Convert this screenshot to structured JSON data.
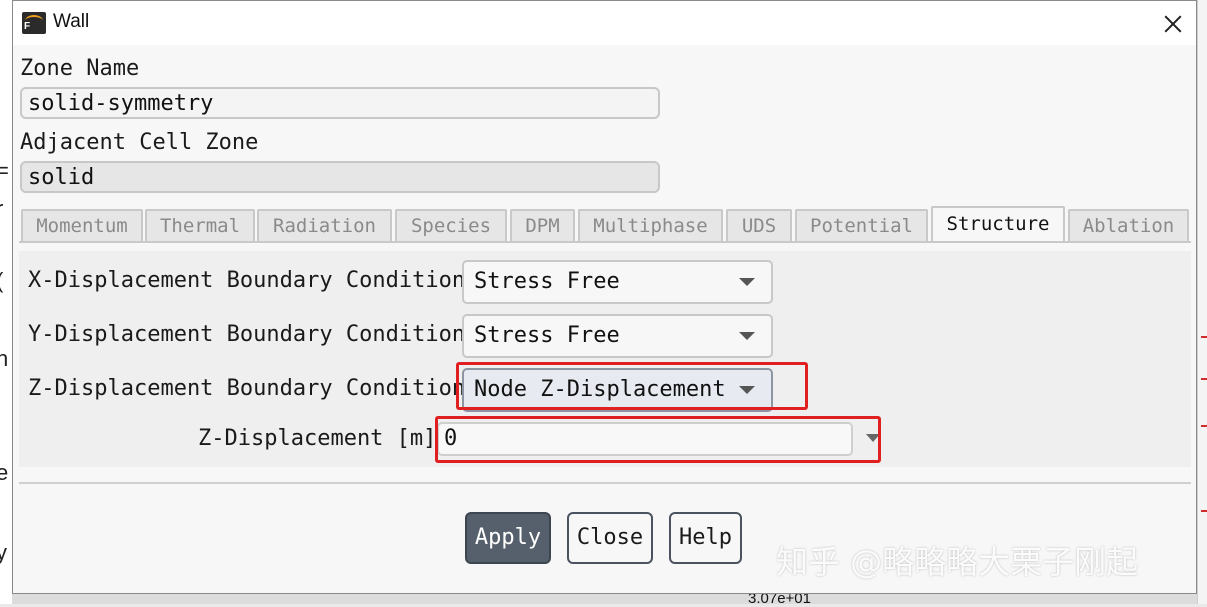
{
  "window": {
    "title": "Wall"
  },
  "fields": {
    "zone_name_label": "Zone Name",
    "zone_name_value": "solid-symmetry",
    "adjacent_cell_zone_label": "Adjacent Cell Zone",
    "adjacent_cell_zone_value": "solid"
  },
  "tabs": [
    {
      "label": "Momentum",
      "active": false
    },
    {
      "label": "Thermal",
      "active": false
    },
    {
      "label": "Radiation",
      "active": false
    },
    {
      "label": "Species",
      "active": false
    },
    {
      "label": "DPM",
      "active": false
    },
    {
      "label": "Multiphase",
      "active": false
    },
    {
      "label": "UDS",
      "active": false
    },
    {
      "label": "Potential",
      "active": false
    },
    {
      "label": "Structure",
      "active": true
    },
    {
      "label": "Ablation",
      "active": false
    }
  ],
  "structure": {
    "x_label": "X-Displacement Boundary Condition",
    "x_value": "Stress Free",
    "y_label": "Y-Displacement Boundary Condition",
    "y_value": "Stress Free",
    "z_label": "Z-Displacement Boundary Condition",
    "z_value": "Node Z-Displacement",
    "z_disp_label": "Z-Displacement [m]",
    "z_disp_value": "0"
  },
  "buttons": {
    "apply": "Apply",
    "close": "Close",
    "help": "Help"
  },
  "watermark": "知乎 @略略略大栗子刚起",
  "background": {
    "bottom_value": "3.07e+01"
  },
  "colors": {
    "highlight": "#e02020",
    "primary_button": "#56606d"
  }
}
